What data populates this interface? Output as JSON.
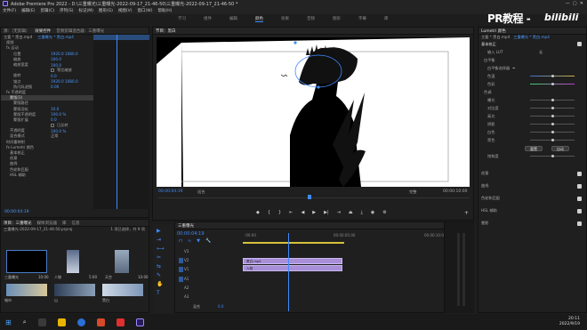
{
  "window": {
    "title": "Adobe Premiere Pro 2022 - D:\\三重曝光\\三重曝光-2022-09-17_21-46-50\\三重曝光-2022-09-17_21-46-50 *"
  },
  "menu": [
    "文件(F)",
    "编辑(E)",
    "剪辑(C)",
    "序列(S)",
    "标记(M)",
    "图形(G)",
    "视图(V)",
    "窗口(W)",
    "帮助(H)"
  ],
  "workspaces": [
    "学习",
    "组件",
    "编辑",
    "颜色",
    "效果",
    "音频",
    "图形",
    "字幕",
    "库"
  ],
  "active_workspace": "颜色",
  "watermark": {
    "text": "PR教程 -",
    "brand": "bilibili"
  },
  "left_panel": {
    "tabs": [
      "源：（无剪辑）",
      "效果控件",
      "音频剪辑混合器：三重曝光",
      "元数据"
    ],
    "master": "主要 * 黑白.mp4",
    "sequence": "三重曝光 * 黑白.mp4",
    "rows": [
      {
        "label": "视频",
        "val": ""
      },
      {
        "label": "fx 运动",
        "val": ""
      },
      {
        "label": "位置",
        "val": "1920.0  1080.0"
      },
      {
        "label": "缩放",
        "val": "100.0"
      },
      {
        "label": "缩放宽度",
        "val": "100.0"
      },
      {
        "label": "",
        "val": "等比缩放"
      },
      {
        "label": "旋转",
        "val": "0.0"
      },
      {
        "label": "锚点",
        "val": "1920.0  1080.0"
      },
      {
        "label": "防闪烁滤镜",
        "val": "0.00"
      },
      {
        "label": "fx 不透明度",
        "val": ""
      },
      {
        "label": "蒙版(1)",
        "val": ""
      },
      {
        "label": "蒙版路径",
        "val": ""
      },
      {
        "label": "蒙版羽化",
        "val": "10.0"
      },
      {
        "label": "蒙版不透明度",
        "val": "100.0 %"
      },
      {
        "label": "蒙版扩展",
        "val": "0.0"
      },
      {
        "label": "",
        "val": "已反转"
      },
      {
        "label": "不透明度",
        "val": "100.0 %"
      },
      {
        "label": "混合模式",
        "val": "正常"
      },
      {
        "label": "时间重映射",
        "val": ""
      },
      {
        "label": "fx Lumetri 颜色",
        "val": ""
      },
      {
        "label": "基本校正",
        "val": ""
      },
      {
        "label": "创意",
        "val": ""
      },
      {
        "label": "曲线",
        "val": ""
      },
      {
        "label": "色轮和匹配",
        "val": ""
      },
      {
        "label": "HSL 辅助",
        "val": ""
      }
    ],
    "timecode": "00:00:04:19"
  },
  "project": {
    "tabs": [
      "项目：三重曝光",
      "媒体浏览器",
      "库",
      "信息"
    ],
    "path": "三重曝光-2022-09-17_21-46-50.prproj",
    "count": "1 项已选择，共 9 项",
    "items": [
      {
        "name": "三重曝光",
        "dur": "10:00"
      },
      {
        "name": "人物",
        "dur": "5:00"
      },
      {
        "name": "天空",
        "dur": "10:00"
      },
      {
        "name": "城市",
        "dur": ""
      },
      {
        "name": "山",
        "dur": ""
      },
      {
        "name": "黑白",
        "dur": ""
      }
    ]
  },
  "program": {
    "tab": "节目：黑白",
    "tc_left": "00:00:04:19",
    "zoom": "适合",
    "quality": "完整",
    "tc_right": "00:00:10:00"
  },
  "timeline": {
    "tab": "三重曝光",
    "timecode": "00:00:04:19",
    "ruler": [
      ":00:00",
      "00:00:05:00",
      "00:00:10:00"
    ],
    "tracks": [
      "V3",
      "V2",
      "V1",
      "A1",
      "A2",
      "A3"
    ],
    "mix_label": "混合",
    "mix_value": "0.0",
    "clips": [
      {
        "label": "黑白.mp4",
        "color": "#a88fd8"
      },
      {
        "label": "人物",
        "color": "#a88fd8"
      }
    ]
  },
  "lumetri": {
    "tab": "Lumetri 颜色",
    "master": "主要 * 黑白.mp4",
    "sequence": "三重曝光 * 黑白.mp4",
    "section": "基本校正",
    "lut_label": "输入 LUT",
    "lut_value": "无",
    "wb_title": "白平衡",
    "wb_picker": "白平衡选择器",
    "temp": "色温",
    "tint": "色彩",
    "tone_title": "色调",
    "tone": [
      "曝光",
      "对比度",
      "高光",
      "阴影",
      "白色",
      "黑色"
    ],
    "auto": "自动",
    "reset": "重置",
    "sat": "饱和度",
    "sections": [
      "创意",
      "曲线",
      "色轮和匹配",
      "HSL 辅助",
      "晕影"
    ],
    "accent": "#3d8bff"
  },
  "taskbar": {
    "time": "20:11",
    "date": "2022/9/19"
  }
}
